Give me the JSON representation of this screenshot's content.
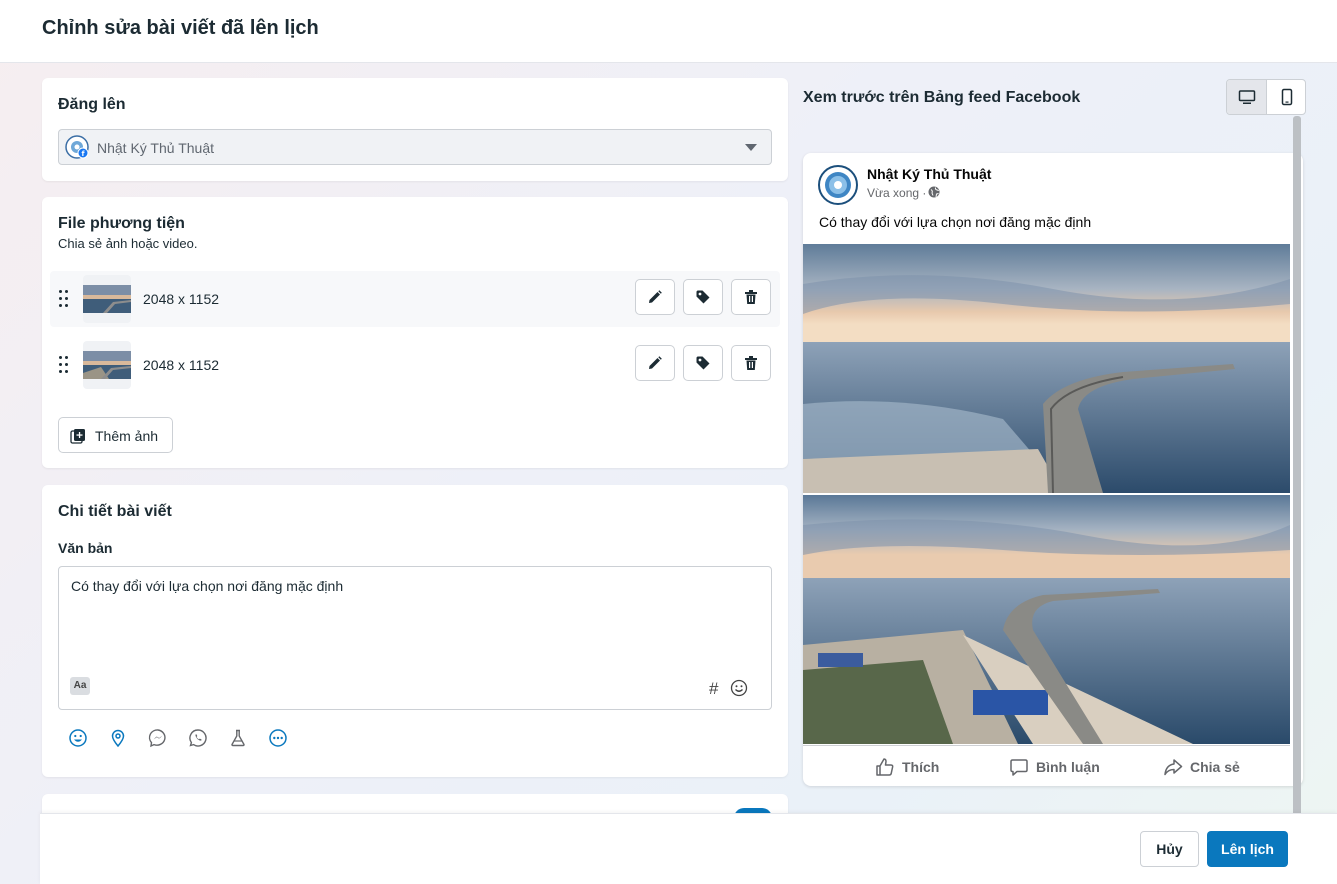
{
  "header": {
    "title": "Chỉnh sửa bài viết đã lên lịch"
  },
  "post_to": {
    "title": "Đăng lên",
    "selected_page": "Nhật Ký Thủ Thuật"
  },
  "media": {
    "title": "File phương tiện",
    "subtitle": "Chia sẻ ảnh hoặc video.",
    "items": [
      {
        "dimensions": "2048 x 1152"
      },
      {
        "dimensions": "2048 x 1152"
      }
    ],
    "add_label": "Thêm ảnh"
  },
  "details": {
    "title": "Chi tiết bài viết",
    "text_label": "Văn bản",
    "text_value": "Có thay đổi với lựa chọn nơi đăng mặc định",
    "aa_label": "Aa",
    "hash_label": "#"
  },
  "footer": {
    "cancel_label": "Hủy",
    "schedule_label": "Lên lịch"
  },
  "preview": {
    "title": "Xem trước trên Bảng feed Facebook",
    "page_name": "Nhật Ký Thủ Thuật",
    "time": "Vừa xong ·",
    "post_text": "Có thay đổi với lựa chọn nơi đăng mặc định",
    "like_label": "Thích",
    "comment_label": "Bình luận",
    "share_label": "Chia sẻ"
  },
  "colors": {
    "accent": "#0a78be",
    "text": "#1c2b33"
  }
}
